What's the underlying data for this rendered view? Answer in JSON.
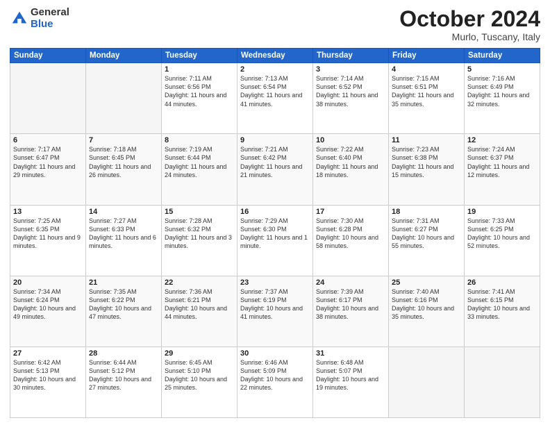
{
  "logo": {
    "general": "General",
    "blue": "Blue"
  },
  "header": {
    "month": "October 2024",
    "location": "Murlo, Tuscany, Italy"
  },
  "days_of_week": [
    "Sunday",
    "Monday",
    "Tuesday",
    "Wednesday",
    "Thursday",
    "Friday",
    "Saturday"
  ],
  "weeks": [
    [
      {
        "day": "",
        "info": ""
      },
      {
        "day": "",
        "info": ""
      },
      {
        "day": "1",
        "info": "Sunrise: 7:11 AM\nSunset: 6:56 PM\nDaylight: 11 hours and 44 minutes."
      },
      {
        "day": "2",
        "info": "Sunrise: 7:13 AM\nSunset: 6:54 PM\nDaylight: 11 hours and 41 minutes."
      },
      {
        "day": "3",
        "info": "Sunrise: 7:14 AM\nSunset: 6:52 PM\nDaylight: 11 hours and 38 minutes."
      },
      {
        "day": "4",
        "info": "Sunrise: 7:15 AM\nSunset: 6:51 PM\nDaylight: 11 hours and 35 minutes."
      },
      {
        "day": "5",
        "info": "Sunrise: 7:16 AM\nSunset: 6:49 PM\nDaylight: 11 hours and 32 minutes."
      }
    ],
    [
      {
        "day": "6",
        "info": "Sunrise: 7:17 AM\nSunset: 6:47 PM\nDaylight: 11 hours and 29 minutes."
      },
      {
        "day": "7",
        "info": "Sunrise: 7:18 AM\nSunset: 6:45 PM\nDaylight: 11 hours and 26 minutes."
      },
      {
        "day": "8",
        "info": "Sunrise: 7:19 AM\nSunset: 6:44 PM\nDaylight: 11 hours and 24 minutes."
      },
      {
        "day": "9",
        "info": "Sunrise: 7:21 AM\nSunset: 6:42 PM\nDaylight: 11 hours and 21 minutes."
      },
      {
        "day": "10",
        "info": "Sunrise: 7:22 AM\nSunset: 6:40 PM\nDaylight: 11 hours and 18 minutes."
      },
      {
        "day": "11",
        "info": "Sunrise: 7:23 AM\nSunset: 6:38 PM\nDaylight: 11 hours and 15 minutes."
      },
      {
        "day": "12",
        "info": "Sunrise: 7:24 AM\nSunset: 6:37 PM\nDaylight: 11 hours and 12 minutes."
      }
    ],
    [
      {
        "day": "13",
        "info": "Sunrise: 7:25 AM\nSunset: 6:35 PM\nDaylight: 11 hours and 9 minutes."
      },
      {
        "day": "14",
        "info": "Sunrise: 7:27 AM\nSunset: 6:33 PM\nDaylight: 11 hours and 6 minutes."
      },
      {
        "day": "15",
        "info": "Sunrise: 7:28 AM\nSunset: 6:32 PM\nDaylight: 11 hours and 3 minutes."
      },
      {
        "day": "16",
        "info": "Sunrise: 7:29 AM\nSunset: 6:30 PM\nDaylight: 11 hours and 1 minute."
      },
      {
        "day": "17",
        "info": "Sunrise: 7:30 AM\nSunset: 6:28 PM\nDaylight: 10 hours and 58 minutes."
      },
      {
        "day": "18",
        "info": "Sunrise: 7:31 AM\nSunset: 6:27 PM\nDaylight: 10 hours and 55 minutes."
      },
      {
        "day": "19",
        "info": "Sunrise: 7:33 AM\nSunset: 6:25 PM\nDaylight: 10 hours and 52 minutes."
      }
    ],
    [
      {
        "day": "20",
        "info": "Sunrise: 7:34 AM\nSunset: 6:24 PM\nDaylight: 10 hours and 49 minutes."
      },
      {
        "day": "21",
        "info": "Sunrise: 7:35 AM\nSunset: 6:22 PM\nDaylight: 10 hours and 47 minutes."
      },
      {
        "day": "22",
        "info": "Sunrise: 7:36 AM\nSunset: 6:21 PM\nDaylight: 10 hours and 44 minutes."
      },
      {
        "day": "23",
        "info": "Sunrise: 7:37 AM\nSunset: 6:19 PM\nDaylight: 10 hours and 41 minutes."
      },
      {
        "day": "24",
        "info": "Sunrise: 7:39 AM\nSunset: 6:17 PM\nDaylight: 10 hours and 38 minutes."
      },
      {
        "day": "25",
        "info": "Sunrise: 7:40 AM\nSunset: 6:16 PM\nDaylight: 10 hours and 35 minutes."
      },
      {
        "day": "26",
        "info": "Sunrise: 7:41 AM\nSunset: 6:15 PM\nDaylight: 10 hours and 33 minutes."
      }
    ],
    [
      {
        "day": "27",
        "info": "Sunrise: 6:42 AM\nSunset: 5:13 PM\nDaylight: 10 hours and 30 minutes."
      },
      {
        "day": "28",
        "info": "Sunrise: 6:44 AM\nSunset: 5:12 PM\nDaylight: 10 hours and 27 minutes."
      },
      {
        "day": "29",
        "info": "Sunrise: 6:45 AM\nSunset: 5:10 PM\nDaylight: 10 hours and 25 minutes."
      },
      {
        "day": "30",
        "info": "Sunrise: 6:46 AM\nSunset: 5:09 PM\nDaylight: 10 hours and 22 minutes."
      },
      {
        "day": "31",
        "info": "Sunrise: 6:48 AM\nSunset: 5:07 PM\nDaylight: 10 hours and 19 minutes."
      },
      {
        "day": "",
        "info": ""
      },
      {
        "day": "",
        "info": ""
      }
    ]
  ]
}
